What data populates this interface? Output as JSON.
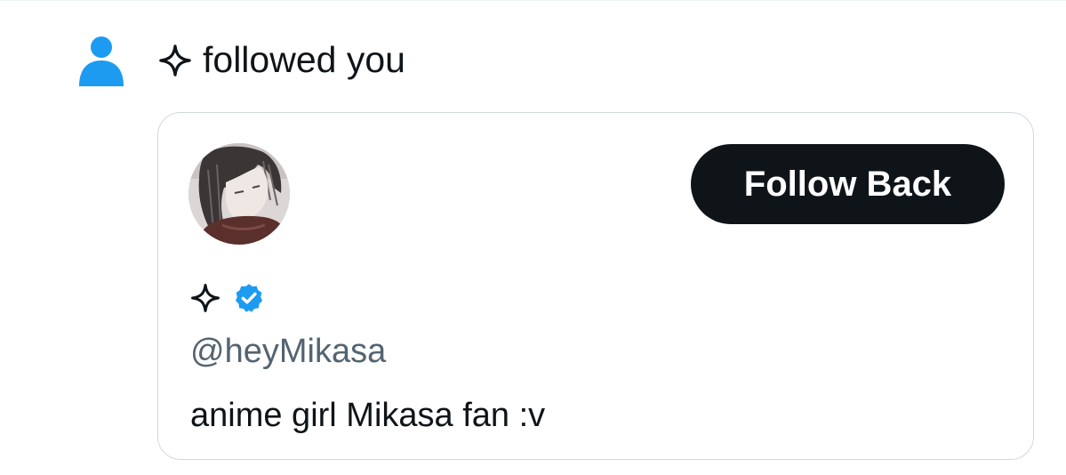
{
  "notification": {
    "icon": "person-icon",
    "icon_color": "#1d9bf0",
    "actor_name_icon": "sparkle-icon",
    "action_text": "followed you"
  },
  "user_card": {
    "avatar": "profile-avatar",
    "follow_button_label": "Follow Back",
    "display_name_icon": "sparkle-icon",
    "verified_badge": "verified-badge-icon",
    "verified_color": "#1d9bf0",
    "handle": "@heyMikasa",
    "bio": "anime girl Mikasa fan :v"
  },
  "colors": {
    "text_primary": "#0f1419",
    "text_secondary": "#536471",
    "button_bg": "#0f1419",
    "button_text": "#ffffff",
    "card_border": "#cfd9de"
  }
}
